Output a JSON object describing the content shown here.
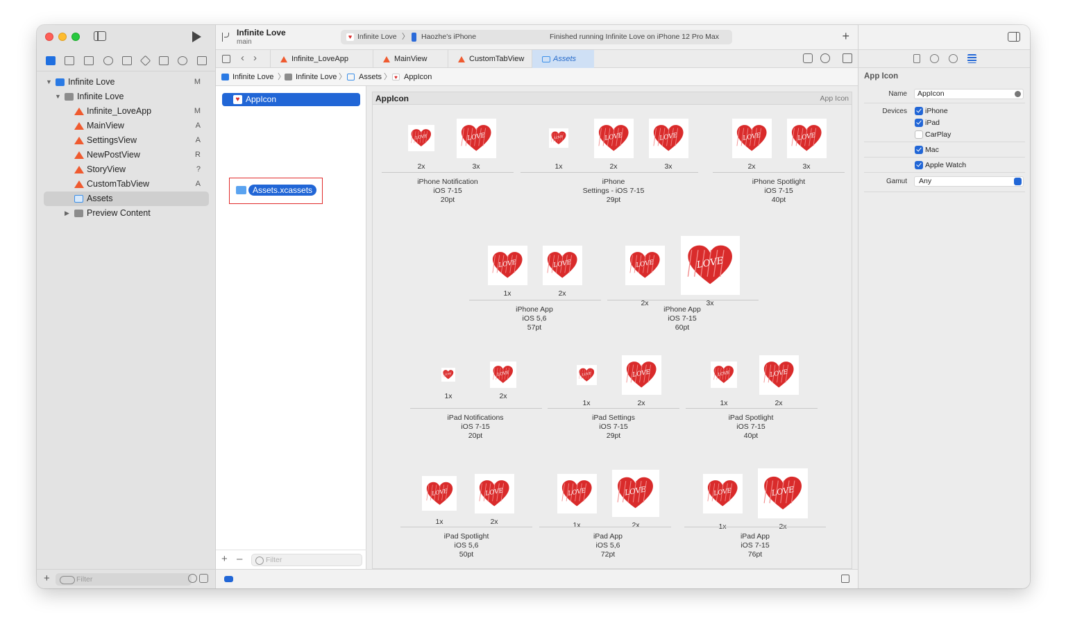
{
  "project": {
    "title": "Infinite Love",
    "branch": "main"
  },
  "activity": {
    "scheme": "Infinite Love",
    "device": "Haozhe's iPhone",
    "status": "Finished running Infinite Love on iPhone 12 Pro Max"
  },
  "navigator": {
    "items": [
      {
        "label": "Infinite Love",
        "status": "M",
        "kind": "project"
      },
      {
        "label": "Infinite Love",
        "status": "",
        "kind": "folder"
      },
      {
        "label": "Infinite_LoveApp",
        "status": "M",
        "kind": "swift"
      },
      {
        "label": "MainView",
        "status": "A",
        "kind": "swift"
      },
      {
        "label": "SettingsView",
        "status": "A",
        "kind": "swift"
      },
      {
        "label": "NewPostView",
        "status": "R",
        "kind": "swift"
      },
      {
        "label": "StoryView",
        "status": "?",
        "kind": "swift"
      },
      {
        "label": "CustomTabView",
        "status": "A",
        "kind": "swift"
      },
      {
        "label": "Assets",
        "status": "",
        "kind": "assets"
      },
      {
        "label": "Preview Content",
        "status": "",
        "kind": "folder"
      }
    ],
    "filter_placeholder": "Filter"
  },
  "tabs": [
    {
      "label": "Infinite_LoveApp"
    },
    {
      "label": "MainView"
    },
    {
      "label": "CustomTabView"
    },
    {
      "label": "Assets"
    }
  ],
  "breadcrumb": [
    "Infinite Love",
    "Infinite Love",
    "Assets",
    "AppIcon"
  ],
  "asset_list": {
    "selected": "AppIcon",
    "drag_item": "Assets.xcassets",
    "filter_placeholder": "Filter"
  },
  "iconset": {
    "name": "AppIcon",
    "kind": "App Icon",
    "groups": [
      {
        "label": [
          "iPhone Notification",
          "iOS 7-15",
          "20pt"
        ],
        "slots": [
          "2x",
          "3x"
        ]
      },
      {
        "label": [
          "iPhone",
          "Settings - iOS 7-15",
          "29pt"
        ],
        "slots": [
          "1x",
          "2x",
          "3x"
        ]
      },
      {
        "label": [
          "iPhone Spotlight",
          "iOS 7-15",
          "40pt"
        ],
        "slots": [
          "2x",
          "3x"
        ]
      },
      {
        "label": [
          "iPhone App",
          "iOS 5,6",
          "57pt"
        ],
        "slots": [
          "1x",
          "2x"
        ]
      },
      {
        "label": [
          "iPhone App",
          "iOS 7-15",
          "60pt"
        ],
        "slots": [
          "2x",
          "3x"
        ]
      },
      {
        "label": [
          "iPad Notifications",
          "iOS 7-15",
          "20pt"
        ],
        "slots": [
          "1x",
          "2x"
        ]
      },
      {
        "label": [
          "iPad Settings",
          "iOS 7-15",
          "29pt"
        ],
        "slots": [
          "1x",
          "2x"
        ]
      },
      {
        "label": [
          "iPad Spotlight",
          "iOS 7-15",
          "40pt"
        ],
        "slots": [
          "1x",
          "2x"
        ]
      },
      {
        "label": [
          "iPad Spotlight",
          "iOS 5,6",
          "50pt"
        ],
        "slots": [
          "1x",
          "2x"
        ]
      },
      {
        "label": [
          "iPad App",
          "iOS 5,6",
          "72pt"
        ],
        "slots": [
          "1x",
          "2x"
        ]
      },
      {
        "label": [
          "iPad App",
          "iOS 7-15",
          "76pt"
        ],
        "slots": [
          "1x",
          "2x"
        ]
      }
    ],
    "heart_text": "LOVE",
    "heart_color": "#d92b2b"
  },
  "inspector": {
    "title": "App Icon",
    "name_label": "Name",
    "name_value": "AppIcon",
    "devices_label": "Devices",
    "devices": [
      {
        "label": "iPhone",
        "checked": true
      },
      {
        "label": "iPad",
        "checked": true
      },
      {
        "label": "CarPlay",
        "checked": false
      },
      {
        "label": "Mac",
        "checked": true
      },
      {
        "label": "Apple Watch",
        "checked": true
      }
    ],
    "gamut_label": "Gamut",
    "gamut_value": "Any"
  },
  "colors": {
    "accent": "#2166d6",
    "selection_outline": "#e02828",
    "swift": "#ef5a2f"
  }
}
